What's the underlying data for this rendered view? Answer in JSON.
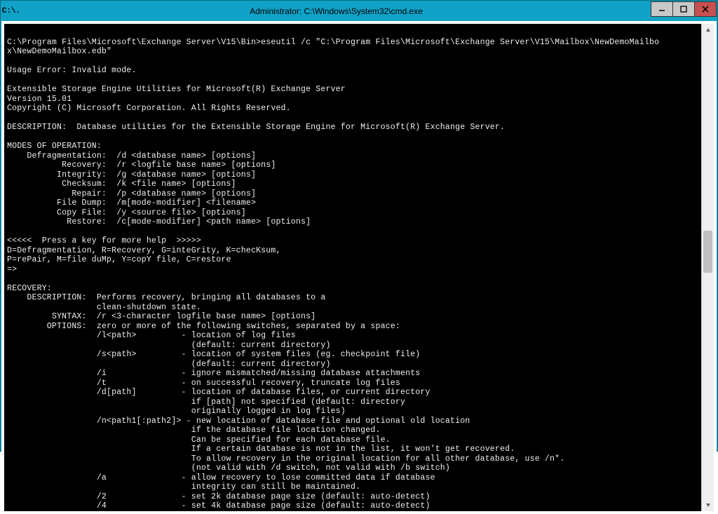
{
  "window": {
    "icon_text": "C:\\.",
    "title": "Administrator: C:\\Windows\\System32\\cmd.exe",
    "min_label": "–",
    "max_label": "□",
    "close_label": "×"
  },
  "terminal": {
    "lines": [
      "",
      "C:\\Program Files\\Microsoft\\Exchange Server\\V15\\Bin>eseutil /c \"C:\\Program Files\\Microsoft\\Exchange Server\\V15\\Mailbox\\NewDemoMailbo",
      "x\\NewDemoMailbox.edb\"",
      "",
      "Usage Error: Invalid mode.",
      "",
      "Extensible Storage Engine Utilities for Microsoft(R) Exchange Server",
      "Version 15.01",
      "Copyright (C) Microsoft Corporation. All Rights Reserved.",
      "",
      "DESCRIPTION:  Database utilities for the Extensible Storage Engine for Microsoft(R) Exchange Server.",
      "",
      "MODES OF OPERATION:",
      "    Defragmentation:  /d <database name> [options]",
      "           Recovery:  /r <logfile base name> [options]",
      "          Integrity:  /g <database name> [options]",
      "           Checksum:  /k <file name> [options]",
      "             Repair:  /p <database name> [options]",
      "          File Dump:  /m[mode-modifier] <filename>",
      "          Copy File:  /y <source file> [options]",
      "            Restore:  /c[mode-modifier] <path name> [options]",
      "",
      "<<<<<  Press a key for more help  >>>>>",
      "D=Defragmentation, R=Recovery, G=inteGrity, K=checKsum,",
      "P=rePair, M=file duMp, Y=copY file, C=restore",
      "=>",
      "",
      "RECOVERY:",
      "    DESCRIPTION:  Performs recovery, bringing all databases to a",
      "                  clean-shutdown state.",
      "         SYNTAX:  /r <3-character logfile base name> [options]",
      "        OPTIONS:  zero or more of the following switches, separated by a space:",
      "                  /l<path>         - location of log files",
      "                                     (default: current directory)",
      "                  /s<path>         - location of system files (eg. checkpoint file)",
      "                                     (default: current directory)",
      "                  /i               - ignore mismatched/missing database attachments",
      "                  /t               - on successful recovery, truncate log files",
      "                  /d[path]         - location of database files, or current directory",
      "                                     if [path] not specified (default: directory",
      "                                     originally logged in log files)",
      "                  /n<path1[:path2]> - new location of database file and optional old location",
      "                                     if the database file location changed.",
      "                                     Can be specified for each database file.",
      "                                     If a certain database is not in the list, it won't get recovered.",
      "                                     To allow recovery in the original location for all other database, use /n*.",
      "                                     (not valid with /d switch, not valid with /b switch)",
      "                  /a               - allow recovery to lose committed data if database",
      "                                     integrity can still be maintained.",
      "                  /2               - set 2k database page size (default: auto-detect)",
      "                  /4               - set 4k database page size (default: auto-detect)"
    ]
  }
}
